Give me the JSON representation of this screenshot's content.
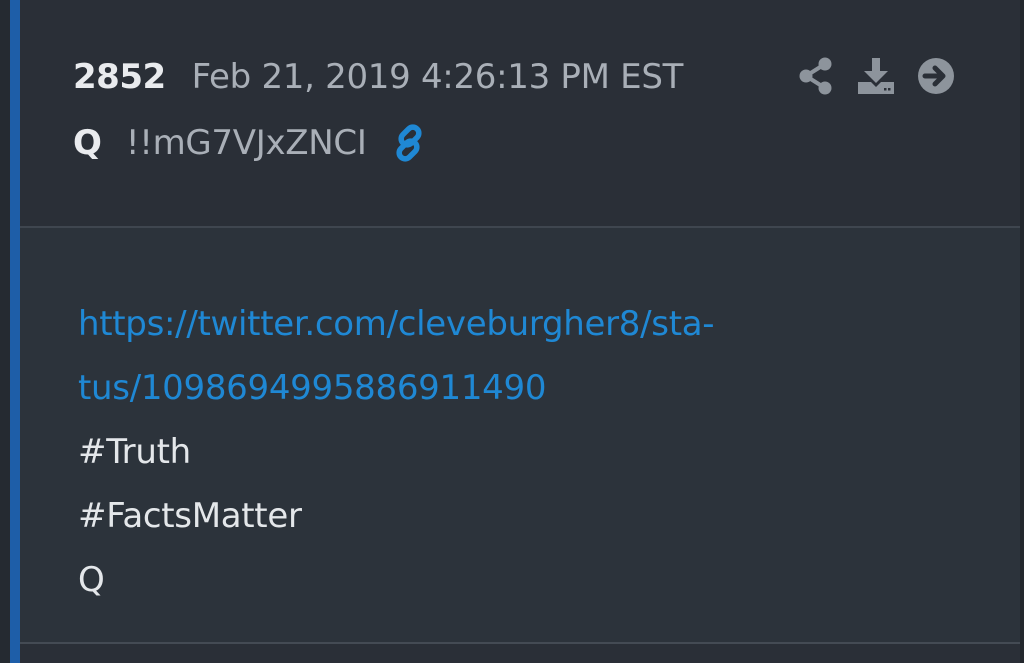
{
  "post": {
    "number": "2852",
    "date": "Feb 21, 2019 4:26:13 PM EST",
    "author": "Q",
    "tripcode": "!!mG7VJxZNCI",
    "icons": {
      "permalink": "link-icon",
      "share": "share-icon",
      "download": "download-icon",
      "next": "arrow-right-circle-icon"
    },
    "link": {
      "line1": "https://twitter.com/cleveburgher8/sta-",
      "line2": "tus/1098694995886911490"
    },
    "lines": [
      "#Truth",
      "#FactsMatter",
      "Q"
    ]
  },
  "colors": {
    "accent": "#1e5ea8",
    "link": "#1f88d4",
    "background": "#2a2f37",
    "text": "#e4e7ea",
    "muted": "#a9afb7",
    "icon": "#8d949c"
  }
}
